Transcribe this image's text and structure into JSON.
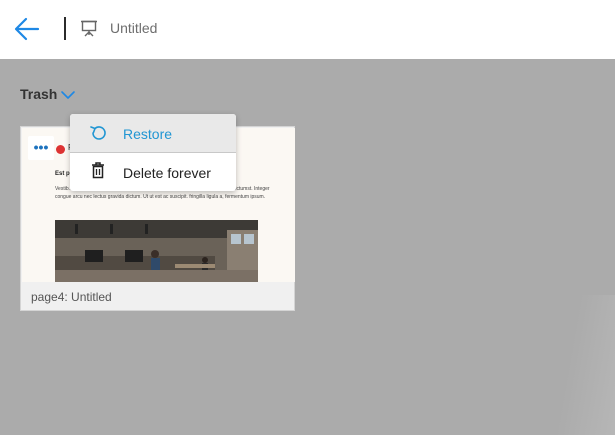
{
  "header": {
    "title": "Untitled",
    "back_icon": "arrow-left-icon",
    "doc_icon": "presentation-icon",
    "accent_color": "#1e88e5"
  },
  "breadcrumb": {
    "label": "Trash",
    "dropdown_icon": "chevron-down-icon"
  },
  "card": {
    "label": "page4: Untitled",
    "more_icon": "ellipsis-icon",
    "more_glyph": "•••",
    "thumbnail": {
      "logo_letter": "F",
      "heading": "Est pro",
      "body": "Vestib... sed libero id lorem volutpat dignissim at iaculis. In hac habitasse platea dictumst. Integer congue arcu nec lectus gravida dictum. Ut ut est ac suscipit. fringilla ligula a, fermentum ipsum."
    }
  },
  "context_menu": {
    "items": [
      {
        "label": "Restore",
        "icon": "restore-icon",
        "highlighted": true,
        "color": "#2196d3"
      },
      {
        "label": "Delete forever",
        "icon": "trash-icon",
        "highlighted": false,
        "color": "#222222"
      }
    ]
  }
}
